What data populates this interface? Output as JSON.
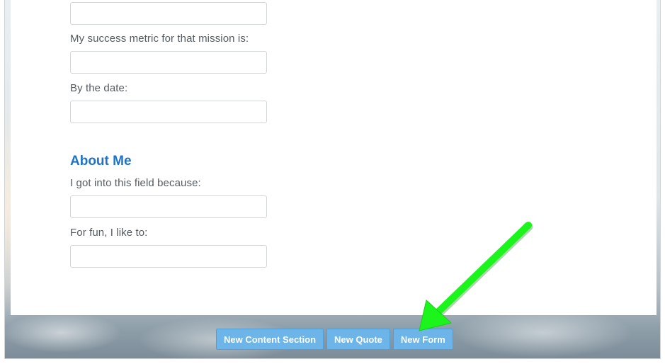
{
  "form": {
    "fields": [
      {
        "label": "",
        "value": "",
        "placeholder": ""
      },
      {
        "label": "My success metric for that mission is:",
        "value": "",
        "placeholder": ""
      },
      {
        "label": "By the date:",
        "value": "",
        "placeholder": ""
      }
    ]
  },
  "about": {
    "title": "About Me",
    "fields": [
      {
        "label": "I got into this field because:",
        "value": "",
        "placeholder": ""
      },
      {
        "label": "For fun, I like to:",
        "value": "",
        "placeholder": ""
      }
    ]
  },
  "toolbar": {
    "new_content_section_label": "New Content Section",
    "new_quote_label": "New Quote",
    "new_form_label": "New Form"
  },
  "colors": {
    "accent": "#1e73c7",
    "button": "#6db5e8",
    "annotation_arrow": "#1bf51b"
  }
}
